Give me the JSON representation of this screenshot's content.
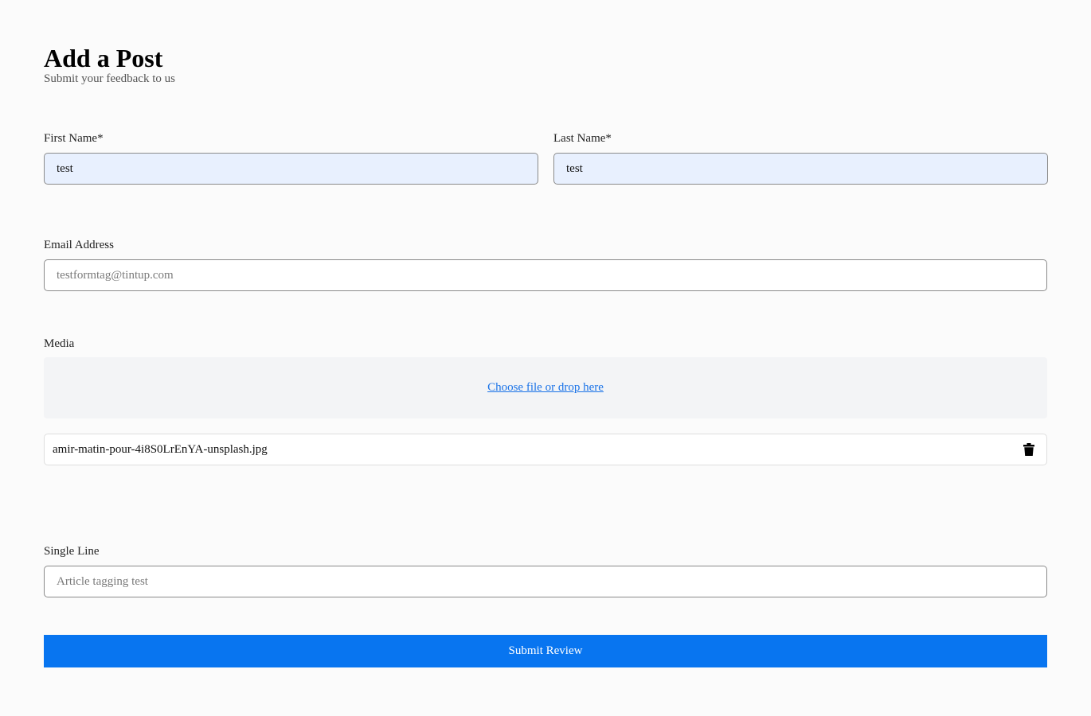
{
  "header": {
    "title": "Add a Post",
    "subtitle": "Submit your feedback to us"
  },
  "fields": {
    "first_name": {
      "label": "First Name*",
      "value": "test"
    },
    "last_name": {
      "label": "Last Name*",
      "value": "test"
    },
    "email": {
      "label": "Email Address",
      "placeholder": "testformtag@tintup.com",
      "value": ""
    },
    "media": {
      "label": "Media",
      "dropzone_text": "Choose file or drop here",
      "file_name": "amir-matin-pour-4i8S0LrEnYA-unsplash.jpg",
      "delete_icon": "trash-icon"
    },
    "single_line": {
      "label": "Single Line",
      "placeholder": "Article tagging test",
      "value": ""
    }
  },
  "actions": {
    "submit_label": "Submit Review"
  },
  "colors": {
    "accent": "#0875f0",
    "link": "#1a73e8",
    "autofill_background": "#e8f0fe",
    "dropzone_background": "#f3f4f6",
    "page_background": "#fbfbfb"
  }
}
